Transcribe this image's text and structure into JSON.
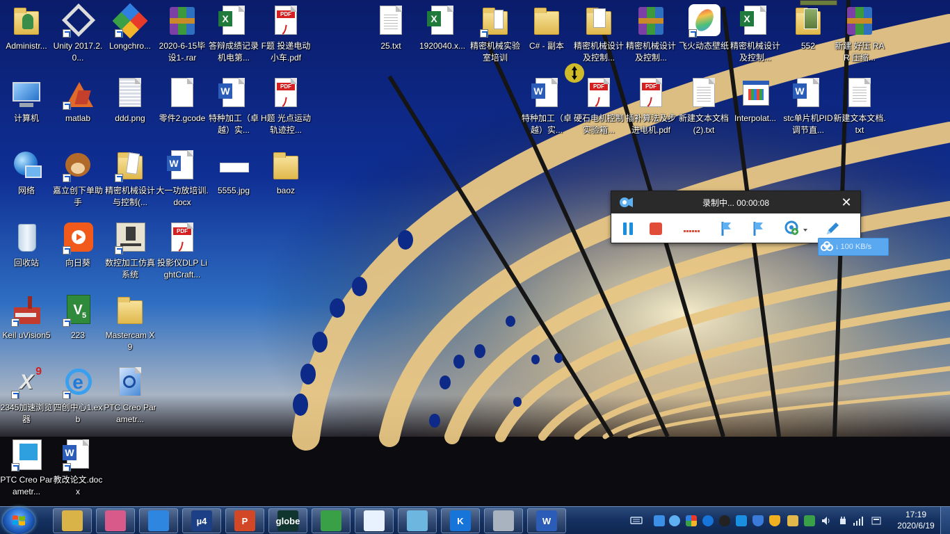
{
  "desktop": {
    "icons": [
      {
        "label": "Administr...",
        "kind": "user-folder"
      },
      {
        "label": "Unity 2017.2.0...",
        "kind": "unity"
      },
      {
        "label": "Longchro...",
        "kind": "longchrome"
      },
      {
        "label": "2020-6-15毕设1-.rar",
        "kind": "rar"
      },
      {
        "label": "答辩成绩记录 机电第...",
        "kind": "excel"
      },
      {
        "label": "F题 投递电动小车.pdf",
        "kind": "pdf"
      },
      {
        "label": "25.txt",
        "kind": "txt"
      },
      {
        "label": "1920040.x...",
        "kind": "excel"
      },
      {
        "label": "精密机械实验室培训",
        "kind": "folder-shortcut"
      },
      {
        "label": "C# - 副本",
        "kind": "folder"
      },
      {
        "label": "精密机械设计及控制...",
        "kind": "folder-docs"
      },
      {
        "label": "精密机械设计及控制...",
        "kind": "rar"
      },
      {
        "label": "飞火动态壁纸",
        "kind": "wallpaper-app"
      },
      {
        "label": "精密机械设计及控制...",
        "kind": "excel"
      },
      {
        "label": "552",
        "kind": "folder-image"
      },
      {
        "label": "新建 好压 RAR 压缩...",
        "kind": "rar"
      },
      {
        "label": "计算机",
        "kind": "computer"
      },
      {
        "label": "matlab",
        "kind": "matlab"
      },
      {
        "label": "ddd.png",
        "kind": "image"
      },
      {
        "label": "零件2.gcode",
        "kind": "blank"
      },
      {
        "label": "特种加工（卓越）实...",
        "kind": "word"
      },
      {
        "label": "H题 光点运动轨迹控...",
        "kind": "pdf"
      },
      {
        "label": "特种加工（卓越）实...",
        "kind": "word"
      },
      {
        "label": "硬石电机控制实验箱...",
        "kind": "pdf"
      },
      {
        "label": "插补算法及步进电机.pdf",
        "kind": "pdf"
      },
      {
        "label": "新建文本文档 (2).txt",
        "kind": "txt"
      },
      {
        "label": "Interpolat...",
        "kind": "app-window"
      },
      {
        "label": "stc单片机PID调节直...",
        "kind": "word"
      },
      {
        "label": "新建文本文档.txt",
        "kind": "txt"
      },
      {
        "label": "网络",
        "kind": "network"
      },
      {
        "label": "嘉立创下单助手",
        "kind": "bear"
      },
      {
        "label": "精密机械设计与控制(...",
        "kind": "folder-shortcut"
      },
      {
        "label": "大一功放培训.docx",
        "kind": "word"
      },
      {
        "label": "5555.jpg",
        "kind": "jpg"
      },
      {
        "label": "baoz",
        "kind": "folder"
      },
      {
        "label": "回收站",
        "kind": "recycle"
      },
      {
        "label": "向日葵",
        "kind": "sunflower"
      },
      {
        "label": "数控加工仿真系统",
        "kind": "cnc"
      },
      {
        "label": "投影仪DLP LightCraft...",
        "kind": "pdf"
      },
      {
        "label": "ER_Factor...",
        "kind": "factory"
      },
      {
        "label": "Keil uVision5",
        "kind": "keil"
      },
      {
        "label": "223",
        "kind": "folder"
      },
      {
        "label": "Mastercam X9",
        "kind": "mastercam"
      },
      {
        "label": "2345加速浏览器",
        "kind": "ie"
      },
      {
        "label": "四创中心1.exb",
        "kind": "exb"
      },
      {
        "label": "PTC Creo Parametr...",
        "kind": "creo"
      },
      {
        "label": "教改论文.docx",
        "kind": "word"
      }
    ]
  },
  "recorder": {
    "status": "录制中... 00:00:08",
    "speed": "100 KB/s",
    "close_label": "✕"
  },
  "taskbar": {
    "items": [
      {
        "name": "explorer",
        "color": "#d9b248",
        "text": ""
      },
      {
        "name": "paint",
        "color": "#d85a8a",
        "text": ""
      },
      {
        "name": "baidu-netdisk",
        "color": "#2f86e0",
        "text": ""
      },
      {
        "name": "mdk",
        "color": "#1c3f85",
        "text": "µ4"
      },
      {
        "name": "powerpoint",
        "color": "#d24726",
        "text": "P"
      },
      {
        "name": "globe-app",
        "color": "#10352e",
        "text": "globe"
      },
      {
        "name": "recycle-app",
        "color": "#3aa048",
        "text": ""
      },
      {
        "name": "creo",
        "color": "#e8f2ff",
        "text": ""
      },
      {
        "name": "window-app",
        "color": "#6cb6e0",
        "text": ""
      },
      {
        "name": "k-app",
        "color": "#1774d8",
        "text": "K"
      },
      {
        "name": "mechanical-app",
        "color": "#a9b3c0",
        "text": ""
      },
      {
        "name": "word",
        "color": "#2b5cb8",
        "text": "W"
      }
    ],
    "clock": {
      "time": "17:19",
      "date": "2020/6/19"
    }
  },
  "colors": {
    "taskbar": "#163262",
    "recorder_title": "#2a2a2a",
    "record_red": "#e24d3a",
    "pause_blue": "#1a8ee0",
    "bubble": "#5aa9f0"
  }
}
